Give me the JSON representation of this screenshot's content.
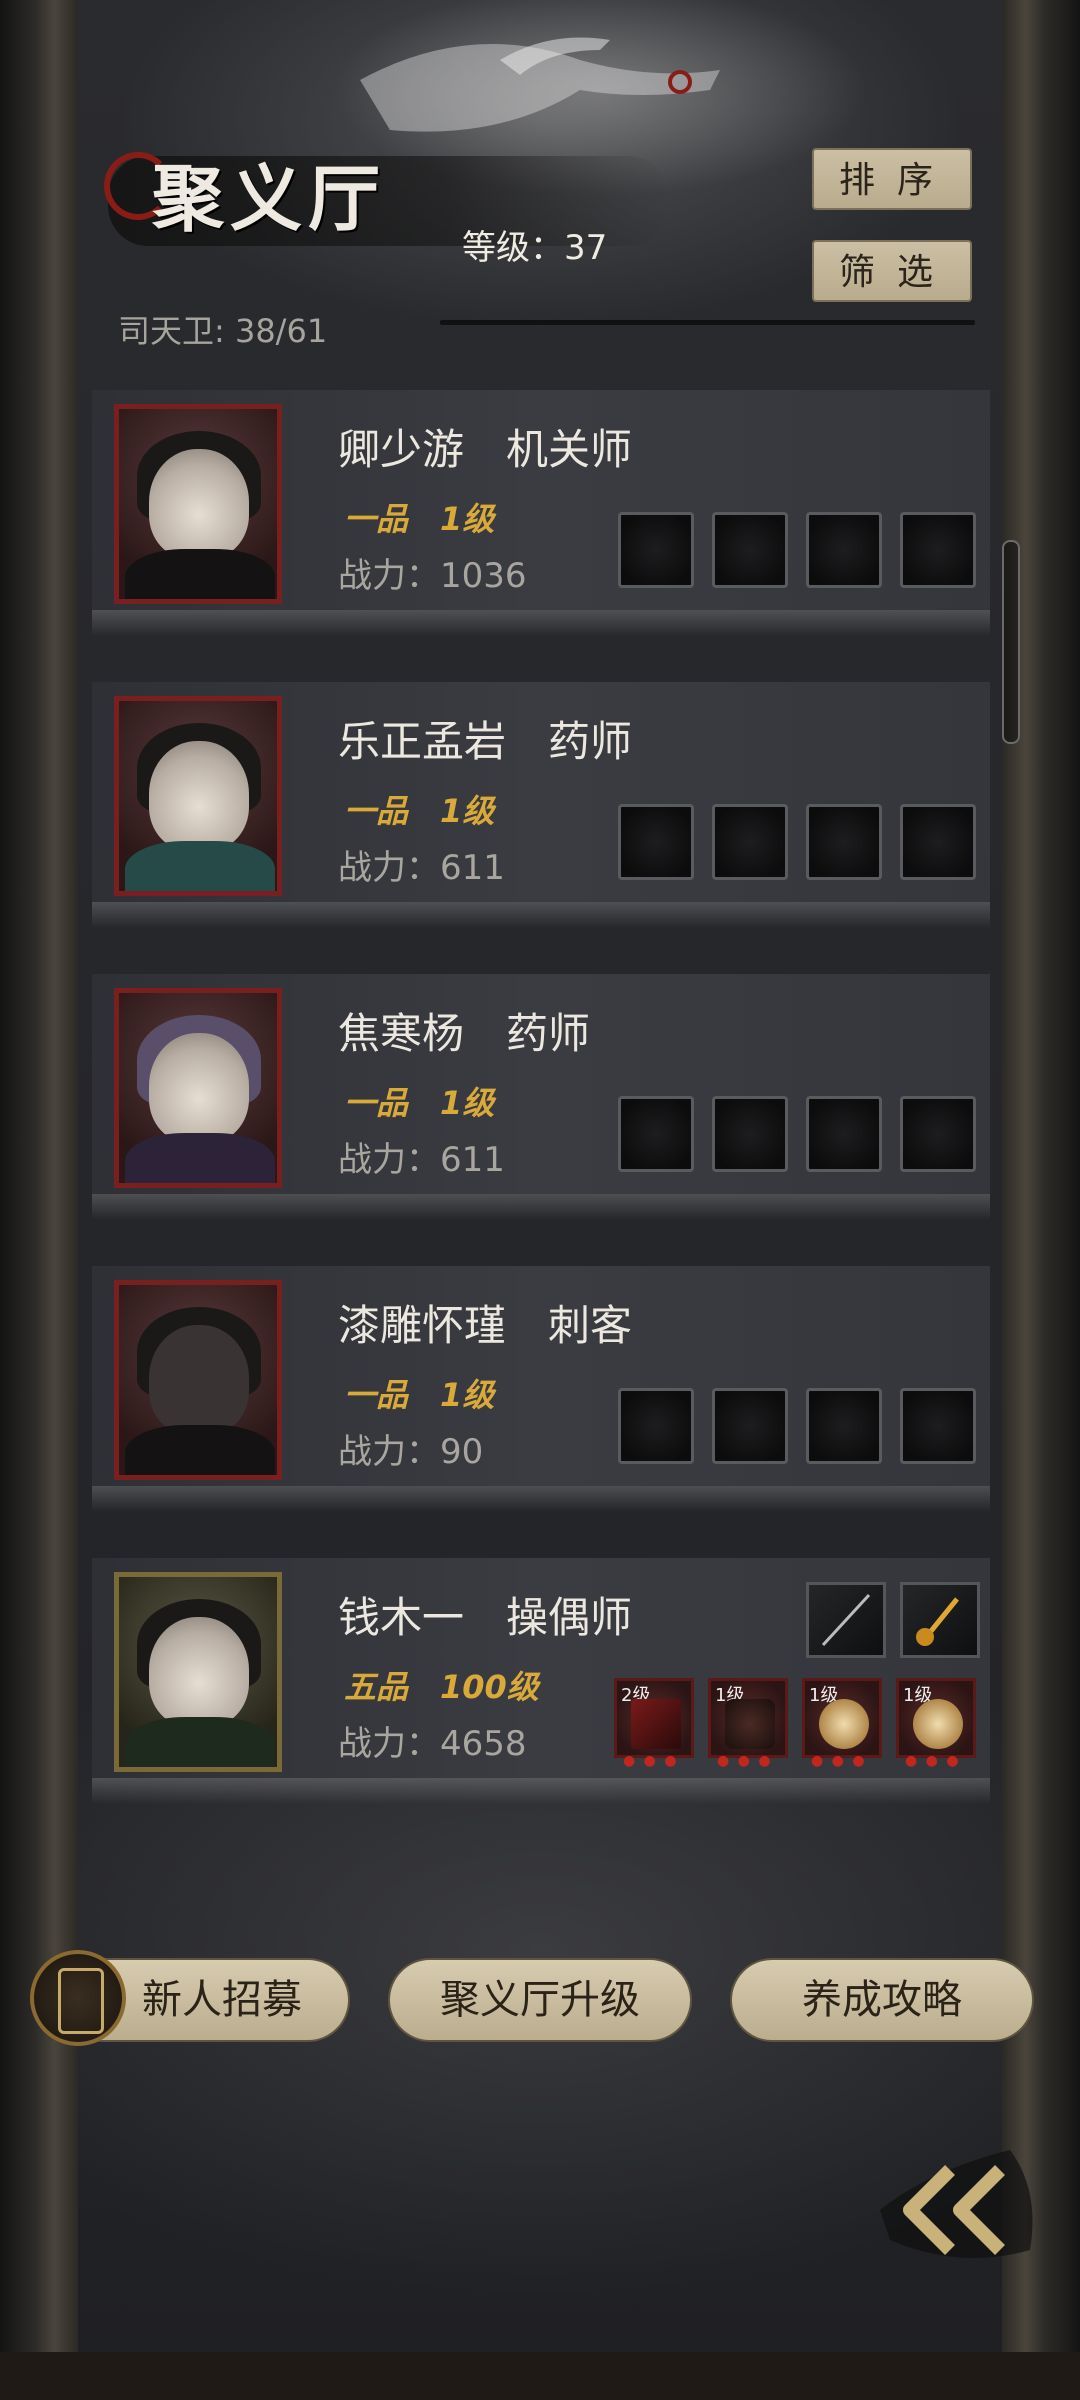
{
  "header": {
    "title": "聚义厅",
    "level": "等级：37",
    "guard": "司天卫: 38/61",
    "sort_label": "排序",
    "filter_label": "筛选"
  },
  "members": [
    {
      "name": "卿少游　机关师",
      "rank": "一品　1级",
      "power": "战力：1036",
      "equipped": false
    },
    {
      "name": "乐正孟岩　药师",
      "rank": "一品　1级",
      "power": "战力：611",
      "equipped": false
    },
    {
      "name": "焦寒杨　药师",
      "rank": "一品　1级",
      "power": "战力：611",
      "equipped": false
    },
    {
      "name": "漆雕怀瑾　刺客",
      "rank": "一品　1级",
      "power": "战力：90",
      "equipped": false
    },
    {
      "name": "钱木一　操偶师",
      "rank": "五品　100级",
      "power": "战力：4658",
      "equipped": true,
      "gear_levels": [
        "2级",
        "1级",
        "1级",
        "1级"
      ]
    }
  ],
  "footer": {
    "recruit_label": "新人招募",
    "upgrade_label": "聚义厅升级",
    "guide_label": "养成攻略"
  },
  "colors": {
    "rank_gold": "#d9a93a",
    "portrait_red": "#7a1f1f",
    "portrait_gold": "#7a6a38",
    "button_tan": "#c9bda2"
  },
  "icons": [
    "back-chevron-icon",
    "recruit-medal-icon",
    "weapon-icon",
    "hammer-icon"
  ]
}
